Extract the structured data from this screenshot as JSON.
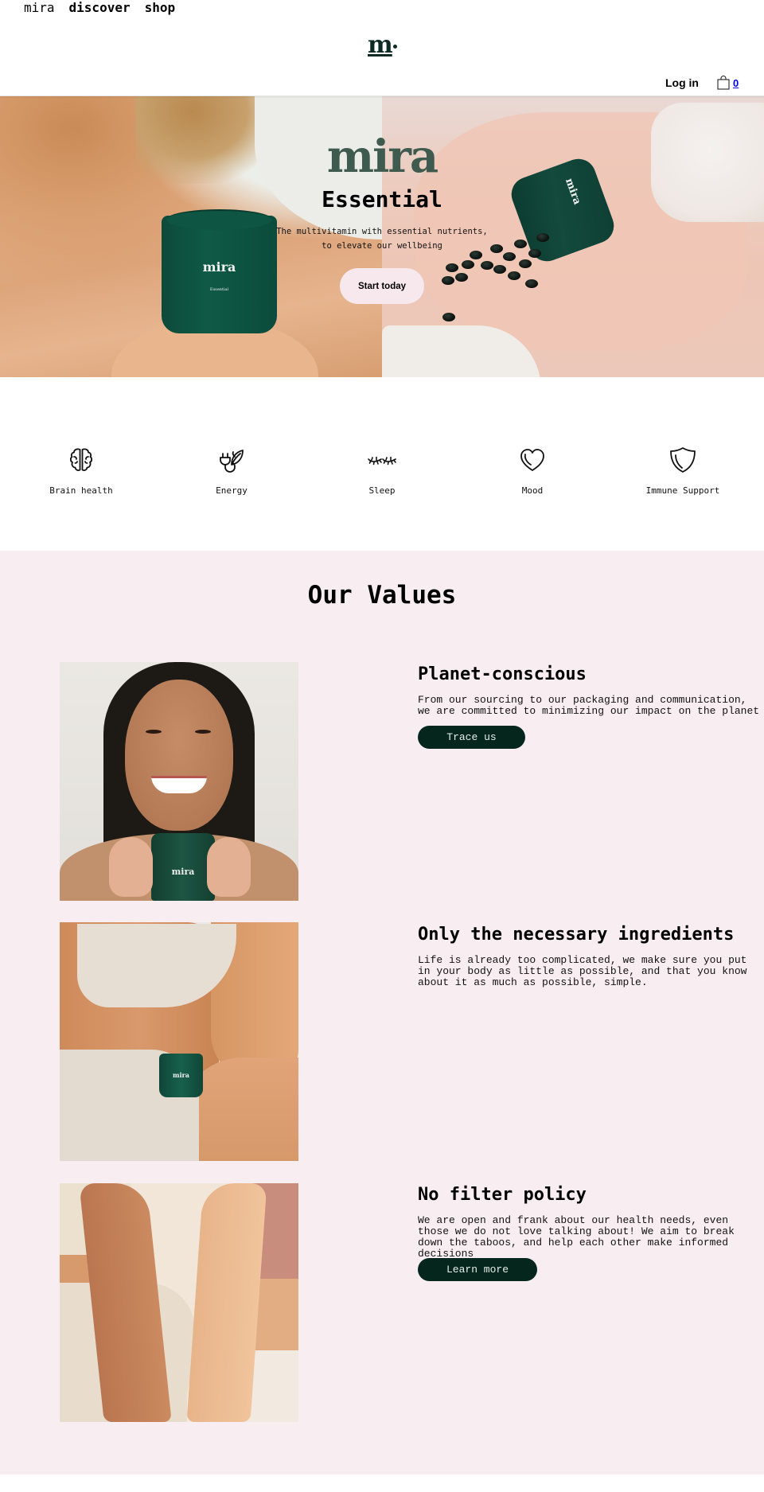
{
  "header": {
    "nav": [
      {
        "label": "mira"
      },
      {
        "label": "discover"
      },
      {
        "label": "shop"
      }
    ],
    "logo_mark": "m",
    "login_label": "Log in",
    "cart_count": "0"
  },
  "hero": {
    "brand_logo": "mira",
    "title": "Essential",
    "subtitle_line1": "The multivitamin with essential nutrients,",
    "subtitle_line2": "to elevate our wellbeing",
    "cta_label": "Start today",
    "jar_brand": "mira",
    "jar_label": "Essential"
  },
  "benefits": [
    {
      "label": "Brain health",
      "icon": "brain-icon"
    },
    {
      "label": "Energy",
      "icon": "plug-leaf-icon"
    },
    {
      "label": "Sleep",
      "icon": "closed-eyes-icon"
    },
    {
      "label": "Mood",
      "icon": "heart-icon"
    },
    {
      "label": "Immune Support",
      "icon": "shield-icon"
    }
  ],
  "values": {
    "title": "Our Values",
    "items": [
      {
        "heading": "Planet-conscious",
        "body": "From our sourcing to our packaging and communication, we are committed to minimizing our impact on the planet",
        "button": "Trace us",
        "jar_brand": "mira"
      },
      {
        "heading": "Only the necessary ingredients",
        "body": "Life is already too complicated, we make sure you put in your body as little as possible, and that you know about it as much as possible, simple.",
        "jar_brand": "mira"
      },
      {
        "heading": "No filter policy",
        "body": "We are open and frank about our health needs, even those we do not love talking about! We aim to break down the taboos, and help each other make informed decisions",
        "button": "Learn more"
      }
    ]
  },
  "colors": {
    "brand_dark_green": "#04261c",
    "logo_green": "#3f5a4f",
    "values_bg": "#f8eef2",
    "cta_pink": "#f6e8ec"
  }
}
